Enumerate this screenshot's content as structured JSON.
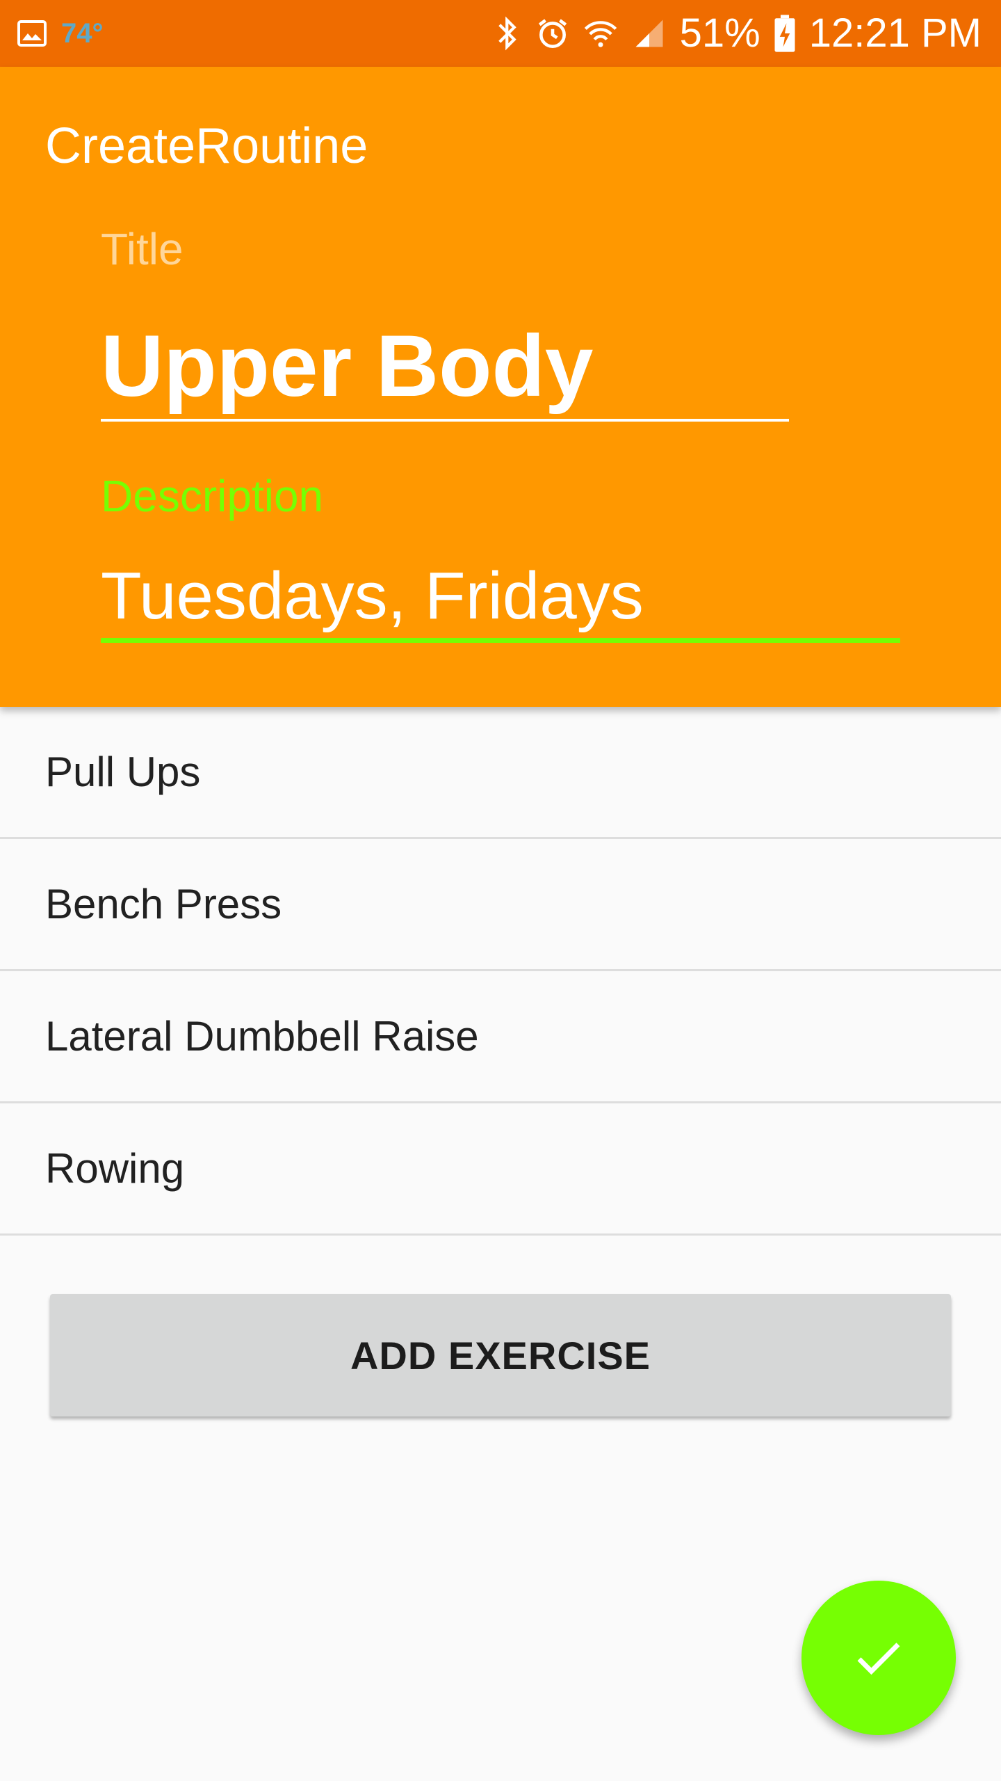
{
  "status_bar": {
    "temperature": "74°",
    "battery": "51%",
    "time": "12:21 PM",
    "icons": [
      "gallery-icon",
      "bluetooth-icon",
      "alarm-icon",
      "wifi-icon",
      "signal-icon",
      "battery-charging-icon"
    ]
  },
  "toolbar": {
    "title": "CreateRoutine"
  },
  "form": {
    "title_label": "Title",
    "title_value": "Upper Body",
    "description_label": "Description",
    "description_value": "Tuesdays, Fridays"
  },
  "exercises": [
    "Pull Ups",
    "Bench Press",
    "Lateral Dumbbell Raise",
    "Rowing"
  ],
  "add_button_label": "ADD EXERCISE",
  "fab": {
    "icon": "check-icon"
  },
  "colors": {
    "status_bar": "#ef6c00",
    "header": "#ff9800",
    "accent": "#76ff03",
    "button": "#d6d7d7",
    "background": "#fafafa"
  }
}
